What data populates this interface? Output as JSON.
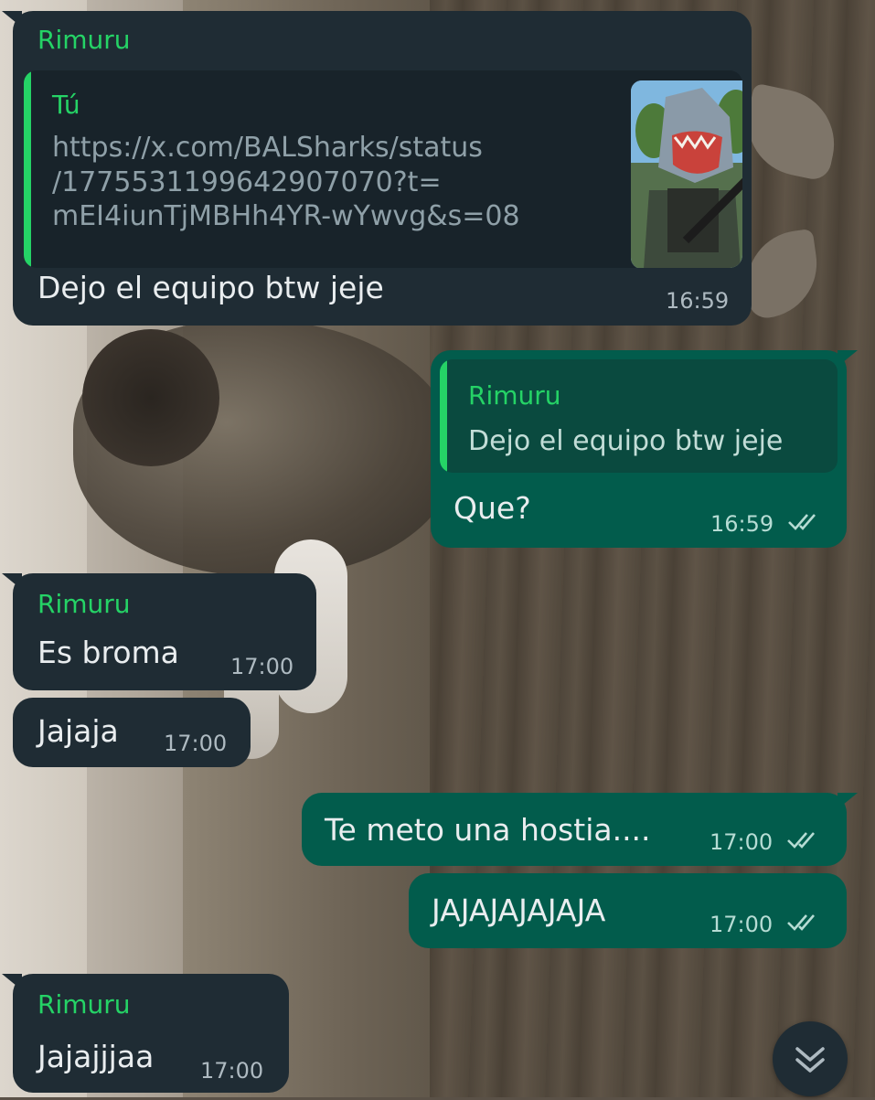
{
  "chat": {
    "messages": [
      {
        "direction": "incoming",
        "sender": "Rimuru",
        "quote": {
          "sender": "Tú",
          "link_lines": [
            "https://x.com/BALSharks/status",
            "/1775531199642907070?t=",
            "mEI4iunTjMBHh4YR-wYwvg&s=08"
          ]
        },
        "text": "Dejo el equipo btw jeje",
        "time": "16:59"
      },
      {
        "direction": "outgoing",
        "quote": {
          "sender": "Rimuru",
          "text": "Dejo el equipo btw jeje"
        },
        "text": "Que?",
        "time": "16:59",
        "status": "read"
      },
      {
        "direction": "incoming",
        "sender": "Rimuru",
        "text": "Es broma",
        "time": "17:00"
      },
      {
        "direction": "incoming",
        "text": "Jajaja",
        "time": "17:00"
      },
      {
        "direction": "outgoing",
        "text": "Te meto una hostia....",
        "time": "17:00",
        "status": "read"
      },
      {
        "direction": "outgoing",
        "text": "JAJAJAJAJAJA",
        "time": "17:00",
        "status": "read"
      },
      {
        "direction": "incoming",
        "sender": "Rimuru",
        "text": "Jajajjjaa",
        "time": "17:00"
      }
    ]
  },
  "icons": {
    "read_ticks": "double-check-icon",
    "scroll_down": "double-chevron-down-icon",
    "thumbnail": "link-preview-thumbnail"
  },
  "colors": {
    "incoming_bubble": "#1f2c34",
    "outgoing_bubble": "#025c4c",
    "sender_name": "#25d366",
    "text": "#e9edef",
    "meta": "#aebac1"
  }
}
